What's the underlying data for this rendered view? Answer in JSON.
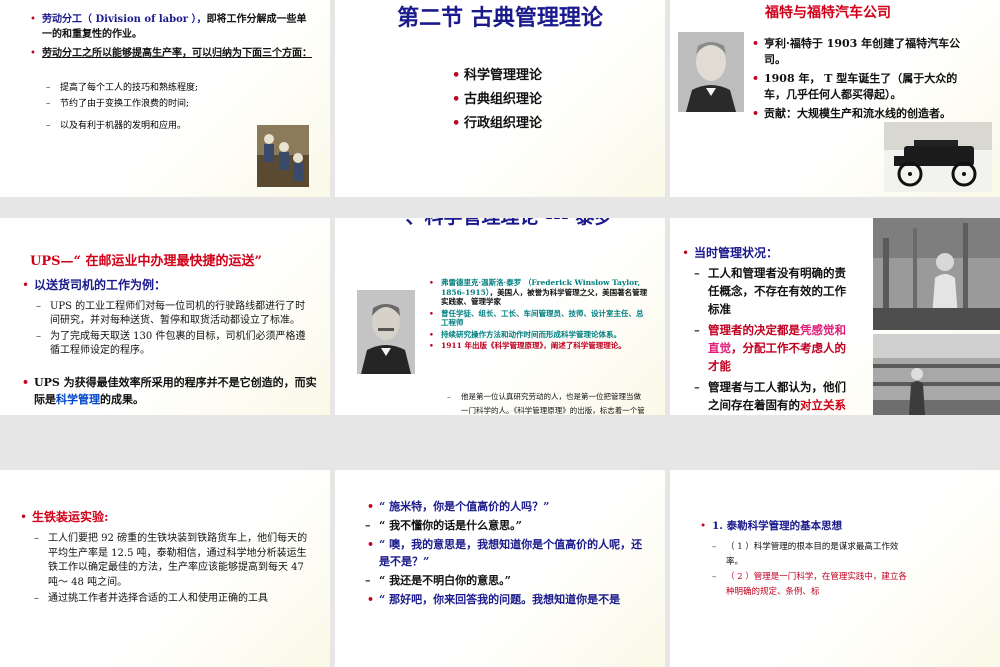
{
  "slide1": {
    "b1_pre": "劳动分工（ Division of labor ），",
    "b1_post": "即将工作分解成一些单一的和重复性的作业。",
    "b2": "劳动分工之所以能够提高生产率，可以归纳为下面三个方面：",
    "d1": "提高了每个工人的技巧和熟练程度;",
    "d2": "节约了由于变换工作浪费的时间;",
    "d3": "以及有利于机器的发明和应用。",
    "image_icon": "assembly-line-photo-icon"
  },
  "slide2": {
    "title": "第二节  古典管理理论",
    "items": [
      "科学管理理论",
      "古典组织理论",
      "行政组织理论"
    ]
  },
  "slide3": {
    "title": "福特与福特汽车公司",
    "b1": "亨利·福特于 1903 年创建了福特汽车公司。",
    "b2": "1908 年， T 型车诞生了（属于大众的车，几乎任何人都买得起）。",
    "b3": "贡献：大规模生产和流水线的创造者。",
    "portrait_icon": "henry-ford-portrait-icon",
    "car_icon": "model-t-car-icon"
  },
  "slide4": {
    "title": "UPS—“ 在邮运业中办理最快捷的运送”",
    "b1": "以送货司机的工作为例：",
    "d1": "UPS 的工业工程师们对每一位司机的行驶路线都进行了时间研究，并对每种送货、暂停和取货活动都设立了标准。",
    "d2": "为了完成每天取送 130 件包裹的目标，司机们必须严格遵循工程师设定的程序。",
    "b2_pre": "UPS 为获得最佳效率所采用的程序并不是它创造的，而实际是",
    "b2_hl": "科学管理",
    "b2_post": "的成果。"
  },
  "slide5": {
    "title": "一、科学管理理论 --- 泰罗",
    "b1": "弗雷德里克·温斯洛·泰罗 （Frederick Winslow Taylor, 1856-1915）",
    "b1_post": "，美国人，被誉为科学管理之父，美国著名管理实践家、管理学家",
    "b2": "曾任学徒、组长、工长、车间管理员、技师、设计室主任、总工程师",
    "b3": "持续研究操作方法和动作时间而形成科学管理论体系。",
    "b4": "1911 年出版《科学管理原理》，阐述了科学管理理论。",
    "d1": "他是第一位认真研究劳动的人，也是第一位把管理当做一门科学的人。《科学管理原理》的出版，标志着一个管理新时代的到来。",
    "portrait_icon": "taylor-portrait-icon"
  },
  "slide6": {
    "title": "当时管理状况：",
    "d1": "工人和管理者没有明确的责任概念，不存在有效的工作标准",
    "d2_pre": "管理者的决定都是",
    "d2_hl": "凭感觉和直觉",
    "d2_post": "，分配工作不考虑人的才能",
    "d3_pre": "管理者与工人都认为，他们之间存在着固有的",
    "d3_hl": "对立关系",
    "photo1_icon": "child-worker-photo-icon",
    "photo2_icon": "textile-mill-photo-icon"
  },
  "slide7": {
    "title": "生铁装运实验:",
    "d1": "工人们要把 92 磅重的生铁块装到铁路货车上，他们每天的平均生产率是 12.5 吨，泰勒相信，通过科学地分析装运生铁工作以确定最佳的方法，生产率应该能够提高到每天 47 吨～ 48 吨之间。",
    "d2": "通过挑工作者并选择合适的工人和使用正确的工具"
  },
  "slide8": {
    "b1": "“ 施米特，你是个值高价的人吗？”",
    "d1": "“ 我不懂你的话是什么意思。”",
    "b2": "“ 噢，我的意思是，我想知道你是个值高价的人呢，还是不是？”",
    "d2": "“ 我还是不明白你的意思。”",
    "b3": "“ 那好吧，你来回答我的问题。我想知道你是不是"
  },
  "slide9": {
    "b1": "1. 泰勒科学管理的基本思想",
    "d1": "（ 1 ）科学管理的根本目的是谋求最高工作效率。",
    "d2": "（ 2 ）管理是一门科学，在管理实践中，建立各种明确的规定、条例、标"
  }
}
